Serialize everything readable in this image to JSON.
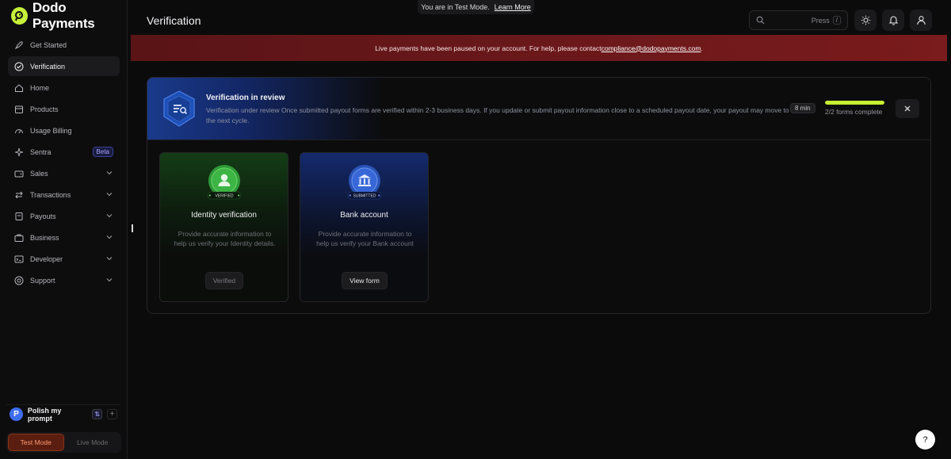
{
  "brand": {
    "name": "Dodo Payments"
  },
  "page": {
    "title": "Verification"
  },
  "test_mode_bar": {
    "text": "You are in Test Mode.",
    "link": "Learn More"
  },
  "search": {
    "placeholder": "Press",
    "shortcut": "/"
  },
  "banner": {
    "text": "Live payments have been paused on your account. For help, please contact ",
    "email": "compliance@dodopayments.com",
    "suffix": "."
  },
  "sidebar": {
    "items": [
      {
        "label": "Get Started",
        "icon": "rocket-icon"
      },
      {
        "label": "Verification",
        "icon": "check-circle-icon",
        "active": true
      },
      {
        "label": "Home",
        "icon": "home-icon"
      },
      {
        "label": "Products",
        "icon": "box-icon"
      },
      {
        "label": "Usage Billing",
        "icon": "gauge-icon"
      },
      {
        "label": "Sentra",
        "icon": "sparkle-icon",
        "badge": "Beta"
      },
      {
        "label": "Sales",
        "icon": "wallet-icon",
        "expandable": true
      },
      {
        "label": "Transactions",
        "icon": "arrows-icon",
        "expandable": true
      },
      {
        "label": "Payouts",
        "icon": "payout-icon",
        "expandable": true
      },
      {
        "label": "Business",
        "icon": "briefcase-icon",
        "expandable": true
      },
      {
        "label": "Developer",
        "icon": "terminal-icon",
        "expandable": true
      },
      {
        "label": "Support",
        "icon": "lifebuoy-icon",
        "expandable": true
      }
    ],
    "workspace": {
      "initial": "P",
      "name": "Polish my prompt"
    },
    "modes": {
      "test": "Test Mode",
      "live": "Live Mode"
    }
  },
  "review": {
    "title": "Verification in review",
    "text": "Verification under review Once submitted payout forms are verified within 2-3 business days. If you update or submit payout information close to a scheduled payout date, your payout may move to the next cycle.",
    "time": "8 min",
    "progress_fraction": 1.0,
    "progress_text": "2/2 forms complete"
  },
  "tiles": [
    {
      "title": "Identity verification",
      "badge": "VERIFIED",
      "desc": "Provide accurate information to help us verify your Identity details.",
      "button": "Verified"
    },
    {
      "title": "Bank account",
      "badge": "SUBMITTED",
      "desc": "Provide accurate information to help us verify your Bank account",
      "button": "View form"
    }
  ],
  "colors": {
    "accent": "#c5ee32",
    "danger_banner": "#6a181a",
    "verified": "#3cb544",
    "submitted": "#3868d8"
  }
}
